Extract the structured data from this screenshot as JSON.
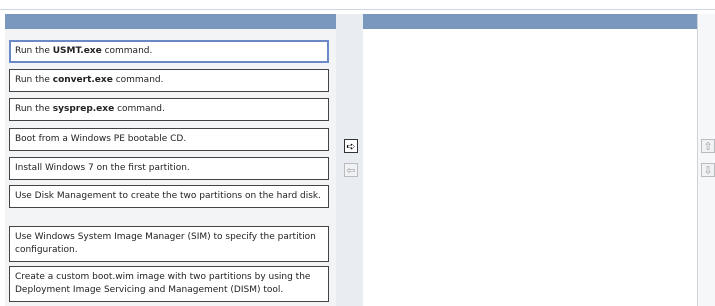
{
  "left_list": {
    "items": [
      {
        "pre": "Run the ",
        "bold": "USMT.exe",
        "post": " command.",
        "selected": true
      },
      {
        "pre": "Run the ",
        "bold": "convert.exe",
        "post": " command.",
        "selected": false
      },
      {
        "pre": "Run the ",
        "bold": "sysprep.exe",
        "post": " command.",
        "selected": false
      },
      {
        "pre": "Boot from a Windows PE bootable CD.",
        "bold": "",
        "post": "",
        "selected": false
      },
      {
        "pre": "Install Windows 7 on the first partition.",
        "bold": "",
        "post": "",
        "selected": false
      },
      {
        "pre": "Use Disk Management to create the two partitions on the hard disk.",
        "bold": "",
        "post": "",
        "selected": false
      },
      {
        "pre": "Use Windows System Image Manager (SIM) to specify the partition configuration.",
        "bold": "",
        "post": "",
        "selected": false
      },
      {
        "pre": "Create a custom boot.wim image with two partitions by using the Deployment Image Servicing and Management (DISM) tool.",
        "bold": "",
        "post": "",
        "selected": false
      }
    ]
  },
  "controls": {
    "move_right_icon": "arrow-right",
    "move_left_icon": "arrow-left",
    "move_up_icon": "arrow-up",
    "move_down_icon": "arrow-down"
  },
  "colors": {
    "header_bar": "#7a97bd",
    "selected_border": "#6b89c9"
  }
}
